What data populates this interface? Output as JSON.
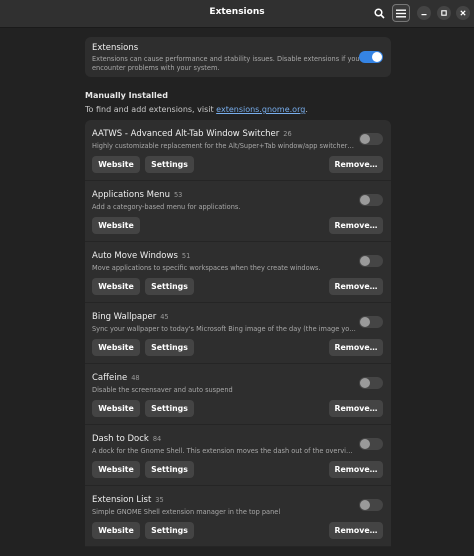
{
  "window": {
    "title": "Extensions"
  },
  "header": {
    "search_icon": "search-icon",
    "menu_icon": "hamburger-menu-icon",
    "minimize_icon": "minimize-icon",
    "maximize_icon": "maximize-icon",
    "close_icon": "close-icon"
  },
  "extensions_toggle": {
    "title": "Extensions",
    "description_line1": "Extensions can cause performance and stability issues. Disable extensions if you",
    "description_line2": "encounter problems with your system.",
    "enabled": true
  },
  "manually_installed": {
    "heading": "Manually Installed",
    "desc_prefix": "To find and add extensions, visit ",
    "link_text": "extensions.gnome.org",
    "desc_suffix": "."
  },
  "buttons": {
    "website": "Website",
    "settings": "Settings",
    "remove": "Remove…"
  },
  "extensions": [
    {
      "name": "AATWS - Advanced Alt-Tab Window Switcher",
      "version": "26",
      "description": "Highly customizable replacement for the Alt/Super+Tab window/app switchers that…",
      "enabled": false,
      "has_settings": true
    },
    {
      "name": "Applications Menu",
      "version": "53",
      "description": "Add a category-based menu for applications.",
      "enabled": false,
      "has_settings": false
    },
    {
      "name": "Auto Move Windows",
      "version": "51",
      "description": "Move applications to specific workspaces when they create windows.",
      "enabled": false,
      "has_settings": true
    },
    {
      "name": "Bing Wallpaper",
      "version": "45",
      "description": "Sync your wallpaper to today's Microsoft Bing image of the day (the image you see w…",
      "enabled": false,
      "has_settings": true
    },
    {
      "name": "Caffeine",
      "version": "48",
      "description": "Disable the screensaver and auto suspend",
      "enabled": false,
      "has_settings": true
    },
    {
      "name": "Dash to Dock",
      "version": "84",
      "description": "A dock for the Gnome Shell. This extension moves the dash out of the overview transf…",
      "enabled": false,
      "has_settings": true
    },
    {
      "name": "Extension List",
      "version": "35",
      "description": "Simple GNOME Shell extension manager in the top panel",
      "enabled": false,
      "has_settings": true
    }
  ],
  "colors": {
    "accent": "#3584e4",
    "link": "#78aeed",
    "card": "#2e2e2e",
    "background": "#222222"
  }
}
